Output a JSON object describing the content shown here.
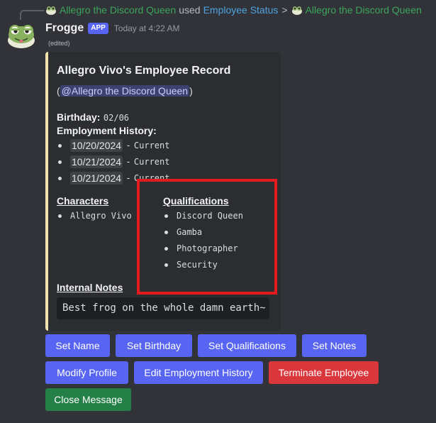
{
  "reply": {
    "user": "Allegro the Discord Queen",
    "used": "used",
    "command": "Employee Status",
    "arrow": ">",
    "target": "Allegro the Discord Queen"
  },
  "author": {
    "name": "Frogge",
    "badge": "APP",
    "timestamp": "Today at 4:22 AM",
    "edited": "(edited)"
  },
  "embed": {
    "accent_color": "#f0e3b0",
    "title": "Allegro Vivo's Employee Record",
    "mention_open": "(",
    "mention": "@Allegro the Discord Queen",
    "mention_close": ")",
    "birthday_label": "Birthday:",
    "birthday_value": "02/06",
    "employment_label": "Employment History:",
    "employment": [
      {
        "date": "10/20/2024",
        "dash": "-",
        "status": "Current"
      },
      {
        "date": "10/21/2024",
        "dash": "-",
        "status": "Current"
      },
      {
        "date": "10/21/2024",
        "dash": "-",
        "status": "Current"
      }
    ],
    "characters_label": "Characters",
    "characters": [
      "Allegro Vivo"
    ],
    "qualifications_label": "Qualifications",
    "qualifications": [
      "Discord Queen",
      "Gamba",
      "Photographer",
      "Security"
    ],
    "notes_label": "Internal Notes",
    "notes": "Best frog on the whole damn earth~"
  },
  "buttons": {
    "set_name": "Set Name",
    "set_birthday": "Set Birthday",
    "set_qualifications": "Set Qualifications",
    "set_notes": "Set Notes",
    "modify_profile": "Modify Profile",
    "edit_employment": "Edit Employment History",
    "terminate": "Terminate Employee",
    "close": "Close Message"
  },
  "colors": {
    "primary": "#5865f2",
    "danger": "#da373c",
    "success": "#248046",
    "highlight": "#e21b1f"
  }
}
